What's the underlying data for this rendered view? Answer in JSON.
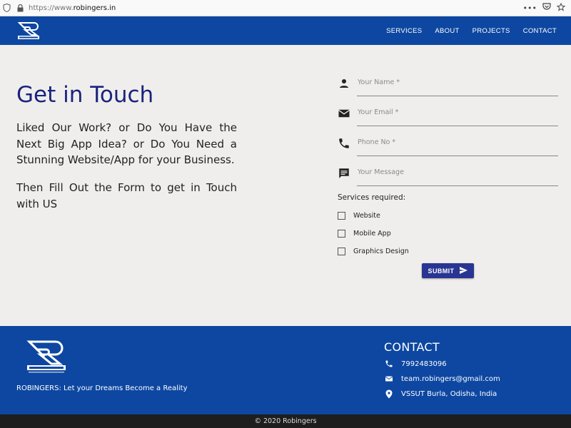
{
  "browser": {
    "url_scheme": "https://www.",
    "url_host": "robingers.in",
    "menu_glyph": "•••"
  },
  "header": {
    "logo_alt": "Robingers",
    "nav": [
      {
        "label": "SERVICES"
      },
      {
        "label": "ABOUT"
      },
      {
        "label": "PROJECTS"
      },
      {
        "label": "CONTACT"
      }
    ]
  },
  "hero": {
    "title": "Get in Touch",
    "paragraph1": "Liked Our Work? or Do You Have the Next Big App Idea? or Do You Need a Stunning Website/App for your Business.",
    "paragraph2": "Then Fill Out the Form to get in Touch with US"
  },
  "form": {
    "fields": [
      {
        "label": "Your Name *",
        "icon": "person-icon"
      },
      {
        "label": "Your Email *",
        "icon": "email-icon"
      },
      {
        "label": "Phone No *",
        "icon": "phone-icon"
      },
      {
        "label": "Your Message",
        "icon": "message-icon"
      }
    ],
    "services_label": "Services required:",
    "services": [
      {
        "label": "Website",
        "checked": false
      },
      {
        "label": "Mobile App",
        "checked": false
      },
      {
        "label": "Graphics Design",
        "checked": false
      }
    ],
    "submit_label": "SUBMIT"
  },
  "footer": {
    "tagline": "ROBINGERS: Let your Dreams Become a Reality",
    "contact_title": "CONTACT",
    "phone": "7992483096",
    "email": "team.robingers@gmail.com",
    "address": "VSSUT Burla, Odisha, India"
  },
  "copyright": "© 2020 Robingers",
  "colors": {
    "primary": "#0d47a1",
    "title": "#1a237e",
    "button": "#283593",
    "page_bg": "#f0eeec",
    "bottom_bar": "#1e1e1e"
  }
}
